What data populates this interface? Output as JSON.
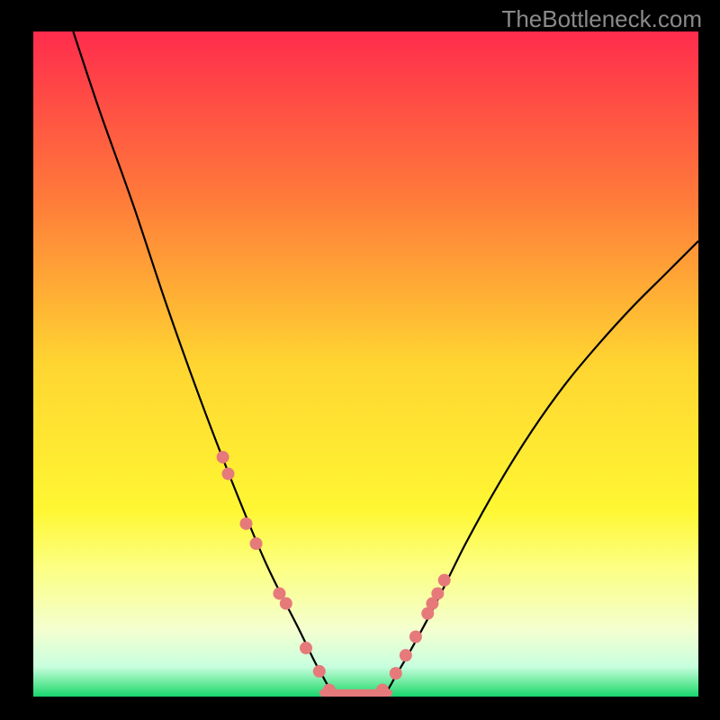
{
  "watermark": "TheBottleneck.com",
  "chart_data": {
    "type": "line",
    "title": "",
    "xlabel": "",
    "ylabel": "",
    "xlim": [
      0,
      1
    ],
    "ylim": [
      0,
      1
    ],
    "gradient_stops": [
      {
        "offset": 0.0,
        "color": "#ff2c4d"
      },
      {
        "offset": 0.25,
        "color": "#ff7a3a"
      },
      {
        "offset": 0.5,
        "color": "#ffd531"
      },
      {
        "offset": 0.72,
        "color": "#fff733"
      },
      {
        "offset": 0.8,
        "color": "#fcff7d"
      },
      {
        "offset": 0.9,
        "color": "#f4ffd0"
      },
      {
        "offset": 0.955,
        "color": "#c8ffde"
      },
      {
        "offset": 0.985,
        "color": "#55e58e"
      },
      {
        "offset": 1.0,
        "color": "#18d46e"
      }
    ],
    "series": [
      {
        "name": "bottleneck-curve",
        "x": [
          0.06,
          0.1,
          0.15,
          0.2,
          0.25,
          0.3,
          0.35,
          0.4,
          0.43,
          0.46,
          0.52,
          0.55,
          0.6,
          0.65,
          0.7,
          0.75,
          0.8,
          0.85,
          0.9,
          0.95,
          1.0
        ],
        "y": [
          1.0,
          0.88,
          0.74,
          0.59,
          0.45,
          0.32,
          0.2,
          0.1,
          0.04,
          0.0,
          0.0,
          0.04,
          0.13,
          0.23,
          0.32,
          0.4,
          0.47,
          0.53,
          0.585,
          0.635,
          0.685
        ]
      }
    ],
    "markers": {
      "name": "highlight-dots",
      "color": "#e67a7a",
      "x": [
        0.285,
        0.293,
        0.32,
        0.335,
        0.37,
        0.38,
        0.41,
        0.43,
        0.445,
        0.525,
        0.545,
        0.56,
        0.575,
        0.593,
        0.6,
        0.608,
        0.618
      ],
      "y": [
        0.36,
        0.335,
        0.26,
        0.23,
        0.155,
        0.14,
        0.073,
        0.038,
        0.01,
        0.01,
        0.035,
        0.062,
        0.09,
        0.125,
        0.14,
        0.155,
        0.175
      ]
    },
    "flat_segment": {
      "x": [
        0.43,
        0.54
      ],
      "y": 0.0,
      "color": "#e67a7a",
      "width_norm": 0.011
    }
  }
}
